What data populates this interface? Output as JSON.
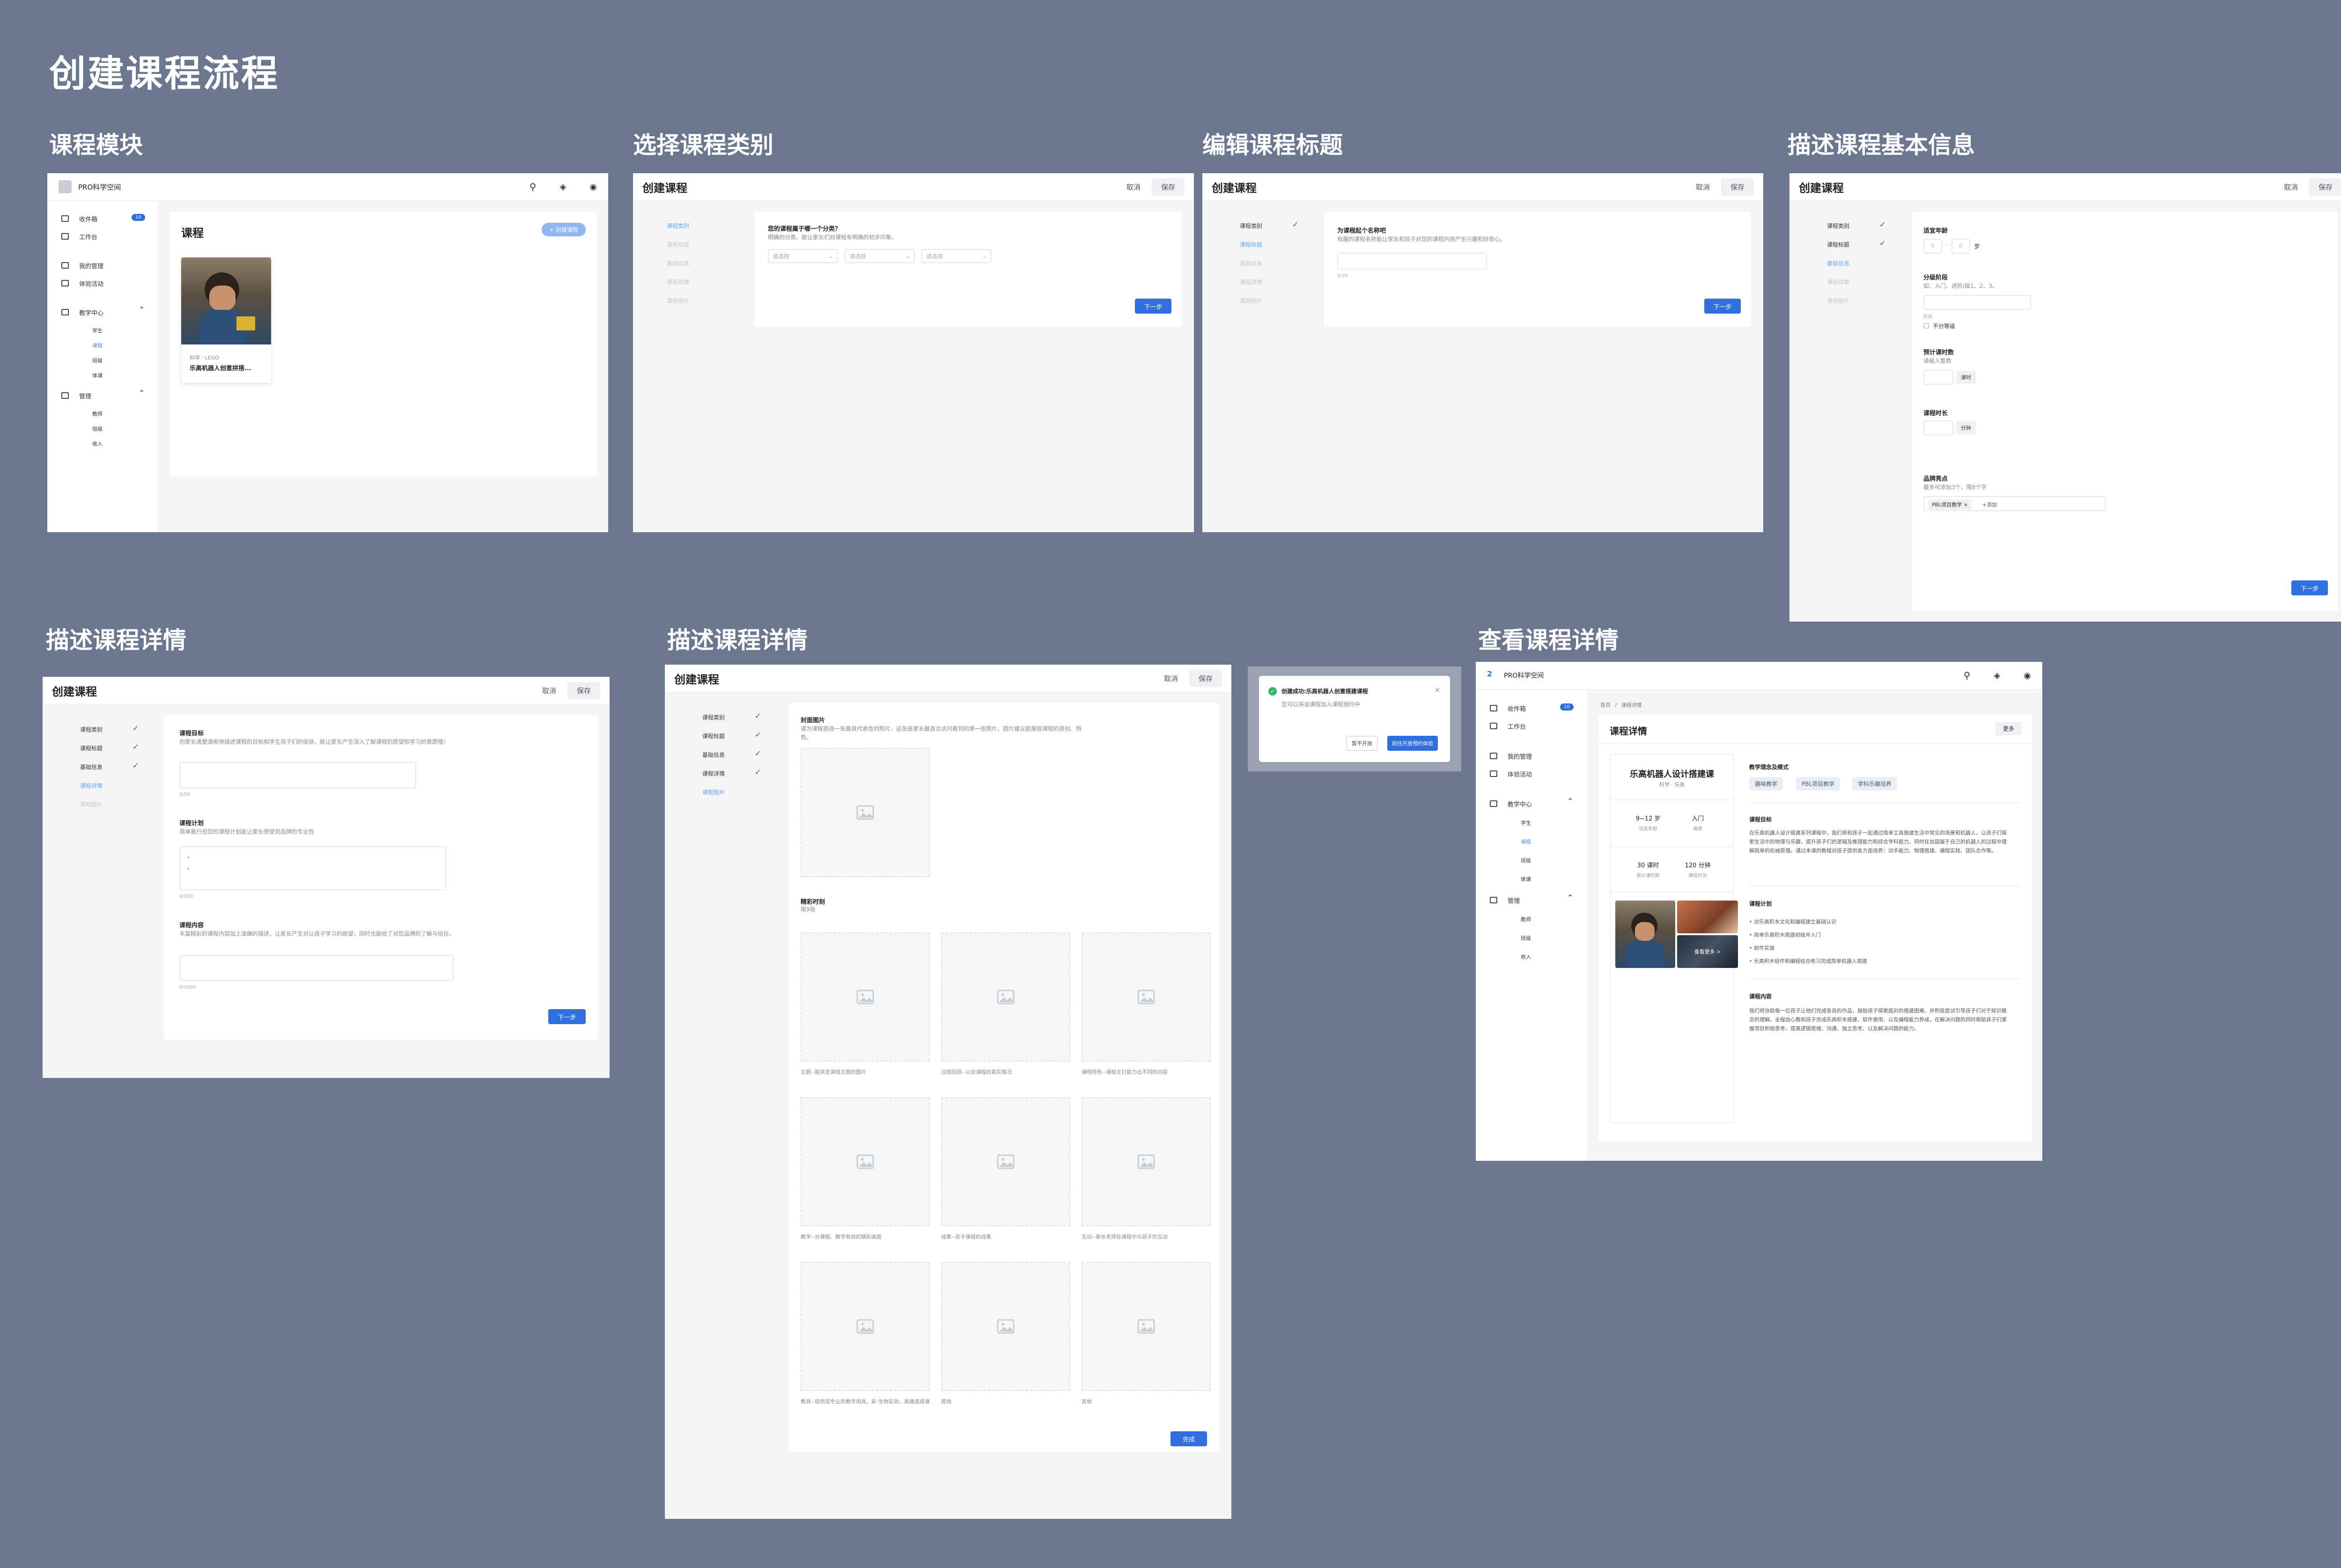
{
  "page_title": "创建课程流程",
  "section_labels": {
    "modules": "课程模块",
    "category": "选择课程类别",
    "title": "编辑课程标题",
    "basic": "描述课程基本信息",
    "detail1": "描述课程详情",
    "detail2": "描述课程详情",
    "view": "查看课程详情"
  },
  "app": {
    "name": "PRO科学空间",
    "sidebar": {
      "inbox": "收件箱",
      "inbox_badge": "10",
      "workbench": "工作台",
      "my_manage": "我的管理",
      "activities": "体验活动",
      "teach_center": "教学中心",
      "teach_items": [
        "学生",
        "课程",
        "班级",
        "体课"
      ],
      "manage": "管理",
      "manage_items": [
        "教师",
        "班级",
        "收入"
      ]
    }
  },
  "modules": {
    "heading": "课程",
    "create_button": "+ 创建课程",
    "course_tag": "科学 · LEGO",
    "course_name": "乐高机器人创意拼搭..."
  },
  "wizard": {
    "title": "创建课程",
    "cancel": "取消",
    "save": "保存",
    "steps": [
      "课程类别",
      "课程标题",
      "基础信息",
      "课程详情",
      "课程图片"
    ],
    "next": "下一步",
    "finish": "完成"
  },
  "category": {
    "question": "您的课程属于哪一个分类？",
    "desc": "明确的分类，能让家长们对课程有明确的初步印象。",
    "selects": [
      "请选择",
      "请选择",
      "请选择"
    ]
  },
  "title_step": {
    "question": "为课程起个名称吧",
    "desc": "有趣的课程名称能让家长和孩子对您的课程内容产生兴趣和好奇心。",
    "counter": "0/30"
  },
  "basic": {
    "age_label": "适宜年龄",
    "age_from": "0",
    "age_sep": "-",
    "age_to": "0",
    "age_unit": "岁",
    "level_label": "分级阶段",
    "level_hint": "如：入门、进阶/级1、2、3。",
    "level_unit": "阶段",
    "no_level": "不分等级",
    "hours_label": "预计课时数",
    "hours_hint": "请输入整数",
    "hours_unit": "课时",
    "duration_label": "课程时长",
    "duration_unit": "分钟",
    "features_label": "品牌亮点",
    "features_hint": "最多可添加3个，限8个字",
    "features_tag": "PBL项目教学",
    "features_add": "+添加"
  },
  "detail1": {
    "goal_label": "课程目标",
    "goal_desc": "向家长清楚清晰地描述课程的目标和学生孩子们的收获，能让家长产生深入了解课程的愿望和学习的意愿哦！",
    "goal_count": "0/50",
    "plan_label": "课程计划",
    "plan_desc": "简单易行但您的课程计划能让家长感受到品牌的专业性",
    "plan_bullets": [
      "•",
      "•"
    ],
    "plan_count": "0/500",
    "content_label": "课程内容",
    "content_desc": "丰富精彩的课程内容加上准确的描述，让家长产生对让孩子学习的欲望，同时也能给了对您品牌的了解与信任。",
    "content_count": "0/1000"
  },
  "detail2": {
    "cover_label": "封面图片",
    "cover_desc": "请为课程挑选一张最具代表性的照片，这张是家长最首次访问看到的第一张照片，图片建议能展现课程的原创、特色。",
    "highlights_label": "精彩时刻",
    "highlights_sub": "限9张",
    "captions": [
      "主题--能突显课程主题的图片",
      "过程回顾--以往课程的真实情况",
      "课程特色--课程主打能力出不同的内容",
      "教学--分课程、教学有效的精彩画面",
      "成果--孩子课程的成果",
      "互动--家长老师在课程中与孩子的互动",
      "教具--提供现专业的教学用具、彩-生物实验，英雄选择课",
      "其他",
      "其他"
    ]
  },
  "dialog": {
    "title": "创建成功:乐高机器人创意搭建课程",
    "desc": "您可以将该课程加入课程预约中",
    "later": "暂不开放",
    "go": "前往开放预约体验"
  },
  "view": {
    "breadcrumb_home": "首页",
    "breadcrumb_sep": "/",
    "breadcrumb_cur": "课程详情",
    "heading": "课程详情",
    "more": "更多",
    "course_name": "乐高机器人设计搭建课",
    "course_tag": "科学 · 乐高",
    "age": "9~12 岁",
    "age_label": "适宜年龄",
    "level": "入门",
    "level_label": "难度",
    "hours": "30 课时",
    "hours_label": "预计课时数",
    "duration": "120 分钟",
    "duration_label": "课程时长",
    "photo_count": "查看更多 >",
    "teach_label": "教学理念及模式",
    "chips": [
      "趣味教学",
      "PBL项目教学",
      "学科乐趣培养"
    ],
    "goal_label": "课程目标",
    "goal_text": "在乐高机器人设计搭建系列课程中，我们将和孩子一起通过简单工具搭建生活中常见的场景和机器人，让孩子们探索生活中的物理与乐趣，提升孩子们的逻辑及推理能力和综合学科能力。同时在加固属于自己的机器人的过程中理解简单的机械原理。通过本课的教程对孩子提供各方面培养：动手能力、物理搭建、编程实践、团队合作等。",
    "plan_label": "课程计划",
    "plan_items": [
      "对乐高积木文化和编程建立基础认识",
      "简单乐高积木搭建初级并入门",
      "软件实操",
      "乐高积木组件和编程结合练习完成简单机器人搭建"
    ],
    "content_label": "课程内容",
    "content_text": "我们将协助每一位孩子让他们完成各自的作品，鼓励孩子探索面对的搭建困难，并积极尝试引导孩子们对于知识概念的理解。全程由心教和孩子完成乐高积木搭建、软件使用、以及编程能力养成，在解决问题的同时帮助孩子们掌握项目积极思考。提高逻辑思维、沟通、独立思考、以及解决问题的能力。"
  },
  "colors": {
    "background": "#6b778f",
    "accent": "#2f6fde",
    "frame_bg": "#ffffff",
    "panel_bg": "#f4f5f7"
  }
}
